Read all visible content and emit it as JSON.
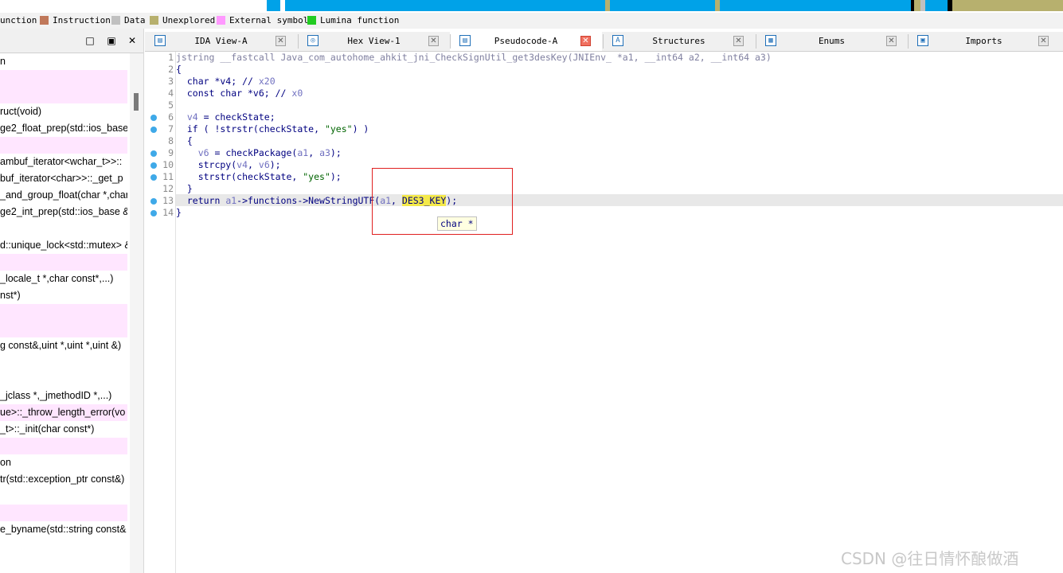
{
  "legend": [
    {
      "label": "Function",
      "display": "unction",
      "color": "#0000ff"
    },
    {
      "label": "Instruction",
      "color": "#c0785a"
    },
    {
      "label": "Data",
      "color": "#c0c0c0"
    },
    {
      "label": "Unexplored",
      "color": "#b7b06e"
    },
    {
      "label": "External symbol",
      "color": "#ff99ff"
    },
    {
      "label": "Lumina function",
      "color": "#22cc22"
    }
  ],
  "left_panel": {
    "buttons": {
      "restore": "□",
      "float": "▣",
      "close": "✕"
    },
    "items": [
      {
        "text": "n",
        "pink": false
      },
      {
        "text": "",
        "pink": true
      },
      {
        "text": "",
        "pink": true
      },
      {
        "text": "ruct(void)",
        "pink": false
      },
      {
        "text": "ge2_float_prep(std::ios_base",
        "pink": false
      },
      {
        "text": "",
        "pink": true
      },
      {
        "text": "ambuf_iterator<wchar_t>>::",
        "pink": false
      },
      {
        "text": "buf_iterator<char>>::_get_p",
        "pink": false
      },
      {
        "text": "_and_group_float(char *,char",
        "pink": false
      },
      {
        "text": "ge2_int_prep(std::ios_base &",
        "pink": false
      },
      {
        "text": "",
        "pink": false
      },
      {
        "text": "d::unique_lock<std::mutex> &",
        "pink": false
      },
      {
        "text": "",
        "pink": true
      },
      {
        "text": "_locale_t *,char const*,...)",
        "pink": false
      },
      {
        "text": "nst*)",
        "pink": false
      },
      {
        "text": "",
        "pink": true
      },
      {
        "text": "",
        "pink": true
      },
      {
        "text": "g const&,uint *,uint *,uint &)",
        "pink": false
      },
      {
        "text": "",
        "pink": false
      },
      {
        "text": "",
        "pink": false
      },
      {
        "text": "_jclass *,_jmethodID *,...)",
        "pink": false
      },
      {
        "text": "ue>::_throw_length_error(vo",
        "pink": true
      },
      {
        "text": "_t>::_init(char const*)",
        "pink": false
      },
      {
        "text": "",
        "pink": true
      },
      {
        "text": "on",
        "pink": false
      },
      {
        "text": "tr(std::exception_ptr const&)",
        "pink": false
      },
      {
        "text": "",
        "pink": false
      },
      {
        "text": "",
        "pink": true
      },
      {
        "text": "e_byname(std::string const&",
        "pink": false
      }
    ]
  },
  "tabs": [
    {
      "label": "IDA View-A",
      "icon": "graph-view-icon",
      "glyph": "▤",
      "active": false
    },
    {
      "label": "Hex View-1",
      "icon": "hex-view-icon",
      "glyph": "◎",
      "active": false
    },
    {
      "label": "Pseudocode-A",
      "icon": "pseudocode-icon",
      "glyph": "▤",
      "active": true
    },
    {
      "label": "Structures",
      "icon": "structures-icon",
      "glyph": "A",
      "active": false
    },
    {
      "label": "Enums",
      "icon": "enums-icon",
      "glyph": "▦",
      "active": false
    },
    {
      "label": "Imports",
      "icon": "imports-icon",
      "glyph": "▣",
      "active": false
    }
  ],
  "code": {
    "lines": [
      {
        "n": "1",
        "dot": false
      },
      {
        "n": "2",
        "dot": false
      },
      {
        "n": "3",
        "dot": false
      },
      {
        "n": "4",
        "dot": false
      },
      {
        "n": "5",
        "dot": false
      },
      {
        "n": "6",
        "dot": true
      },
      {
        "n": "7",
        "dot": true
      },
      {
        "n": "8",
        "dot": false
      },
      {
        "n": "9",
        "dot": true
      },
      {
        "n": "10",
        "dot": true
      },
      {
        "n": "11",
        "dot": true
      },
      {
        "n": "12",
        "dot": false
      },
      {
        "n": "13",
        "dot": true
      },
      {
        "n": "14",
        "dot": true
      }
    ],
    "tokens": {
      "l1_ret": "jstring __fastcall Java_com_autohome_ahkit_jni_CheckSignUtil_get3desKey(JNIEnv_ *a1, __int64 a2, __int64 a3)",
      "l2": "{",
      "l3_a": "  char *v4; // ",
      "l3_b": "x20",
      "l4_a": "  const char *v6; // ",
      "l4_b": "x0",
      "l6_a": "  ",
      "l6_v": "v4",
      "l6_b": " = checkState;",
      "l7_a": "  if ( !strstr(checkState, ",
      "l7_s": "\"yes\"",
      "l7_b": ") )",
      "l8": "  {",
      "l9_a": "    ",
      "l9_v": "v6",
      "l9_b": " = checkPackage(",
      "l9_c": "a1",
      "l9_d": ", ",
      "l9_e": "a3",
      "l9_f": ");",
      "l10_a": "    strcpy(",
      "l10_b": "v4",
      "l10_c": ", ",
      "l10_d": "v6",
      "l10_e": ");",
      "l11_a": "    strstr(checkState, ",
      "l11_s": "\"yes\"",
      "l11_b": ");",
      "l12": "  }",
      "l13_a": "  return ",
      "l13_b": "a1",
      "l13_c": "->functions->NewStringUTF(",
      "l13_d": "a1",
      "l13_e": ", ",
      "l13_hl": "DES3_KEY",
      "l13_f": ");",
      "l14": "}"
    },
    "tooltip": "char *"
  },
  "watermark": "CSDN @往日情怀酿做酒"
}
